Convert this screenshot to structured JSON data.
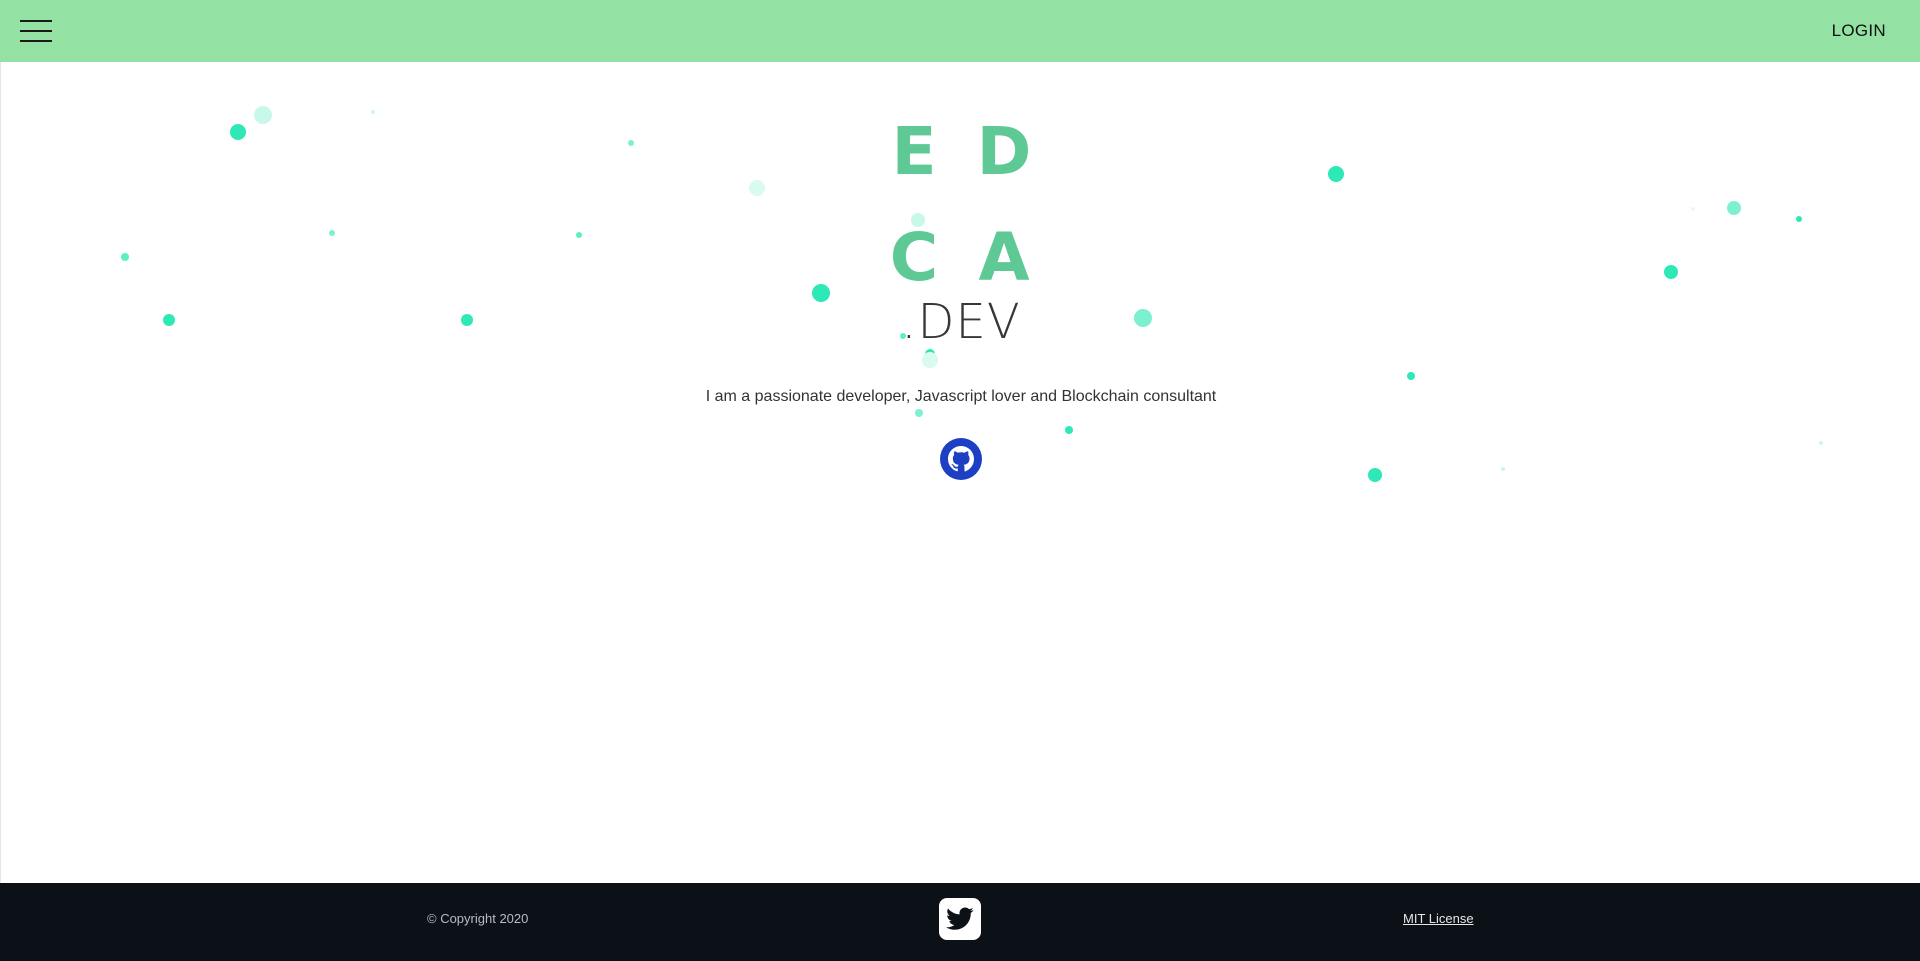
{
  "header": {
    "menu_icon": "hamburger-menu-icon",
    "login_label": "LOGIN"
  },
  "hero": {
    "logo_letters": [
      "E",
      "D",
      "C",
      "A"
    ],
    "logo_suffix": ".DEV",
    "tagline": "I am a passionate developer, Javascript lover and Blockchain consultant",
    "social_icon": "github-icon"
  },
  "footer": {
    "copyright": "© Copyright 2020",
    "social_icon": "twitter-icon",
    "license_label": "MIT License"
  },
  "colors": {
    "header_bg": "#93e2a3",
    "logo_green": "#5fc995",
    "particle": "#2ee8b6",
    "github_blue": "#1c3fc4",
    "footer_bg": "#0c1117"
  }
}
